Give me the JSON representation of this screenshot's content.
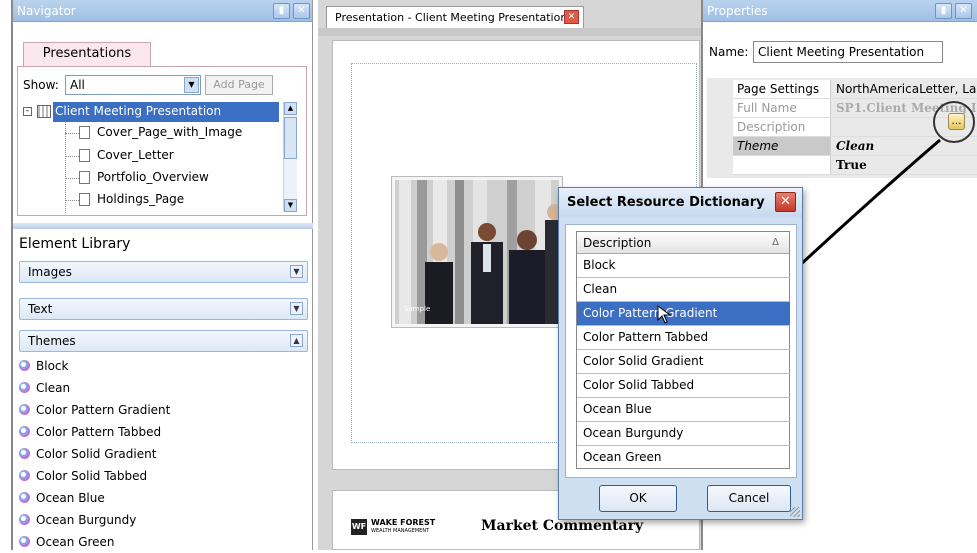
{
  "navigator": {
    "title": "Navigator",
    "tab": "Presentations",
    "show_label": "Show:",
    "show_value": "All",
    "add_page": "Add Page",
    "tree": {
      "root": "Client Meeting Presentation",
      "children": [
        "Cover_Page_with_Image",
        "Cover_Letter",
        "Portfolio_Overview",
        "Holdings_Page"
      ]
    }
  },
  "element_library": {
    "title": "Element Library",
    "sections": [
      "Images",
      "Text",
      "Themes"
    ],
    "themes": [
      "Block",
      "Clean",
      "Color Pattern Gradient",
      "Color Pattern Tabbed",
      "Color Solid Gradient",
      "Color Solid Tabbed",
      "Ocean Blue",
      "Ocean Burgundy",
      "Ocean Green"
    ]
  },
  "document": {
    "tab_title": "Presentation - Client Meeting Presentation",
    "photo_caption": "Sample",
    "footer_logo": "WF",
    "footer_brand_top": "WAKE FOREST",
    "footer_brand_bottom": "WEALTH MANAGEMENT",
    "footer_heading": "Market Commentary"
  },
  "properties": {
    "title": "Properties",
    "name_label": "Name:",
    "name_value": "Client Meeting Presentation",
    "rows": [
      {
        "key": "Page Settings",
        "value": "NorthAmericaLetter, Lan"
      },
      {
        "key": "Full Name",
        "value": "SP1.Client Meeting I"
      },
      {
        "key": "Description",
        "value": ""
      },
      {
        "key": "Theme",
        "value": "Clean"
      },
      {
        "key": "",
        "value": "True"
      }
    ]
  },
  "dialog": {
    "title": "Select Resource Dictionary",
    "column_header": "Description",
    "items": [
      "Block",
      "Clean",
      "Color Pattern Gradient",
      "Color Pattern Tabbed",
      "Color Solid Gradient",
      "Color Solid Tabbed",
      "Ocean Blue",
      "Ocean Burgundy",
      "Ocean Green"
    ],
    "selected_index": 2,
    "ok": "OK",
    "cancel": "Cancel"
  },
  "colors": {
    "selection": "#3a6fc4",
    "titlebar": "#9fbfe4",
    "close_red": "#d9493a"
  }
}
